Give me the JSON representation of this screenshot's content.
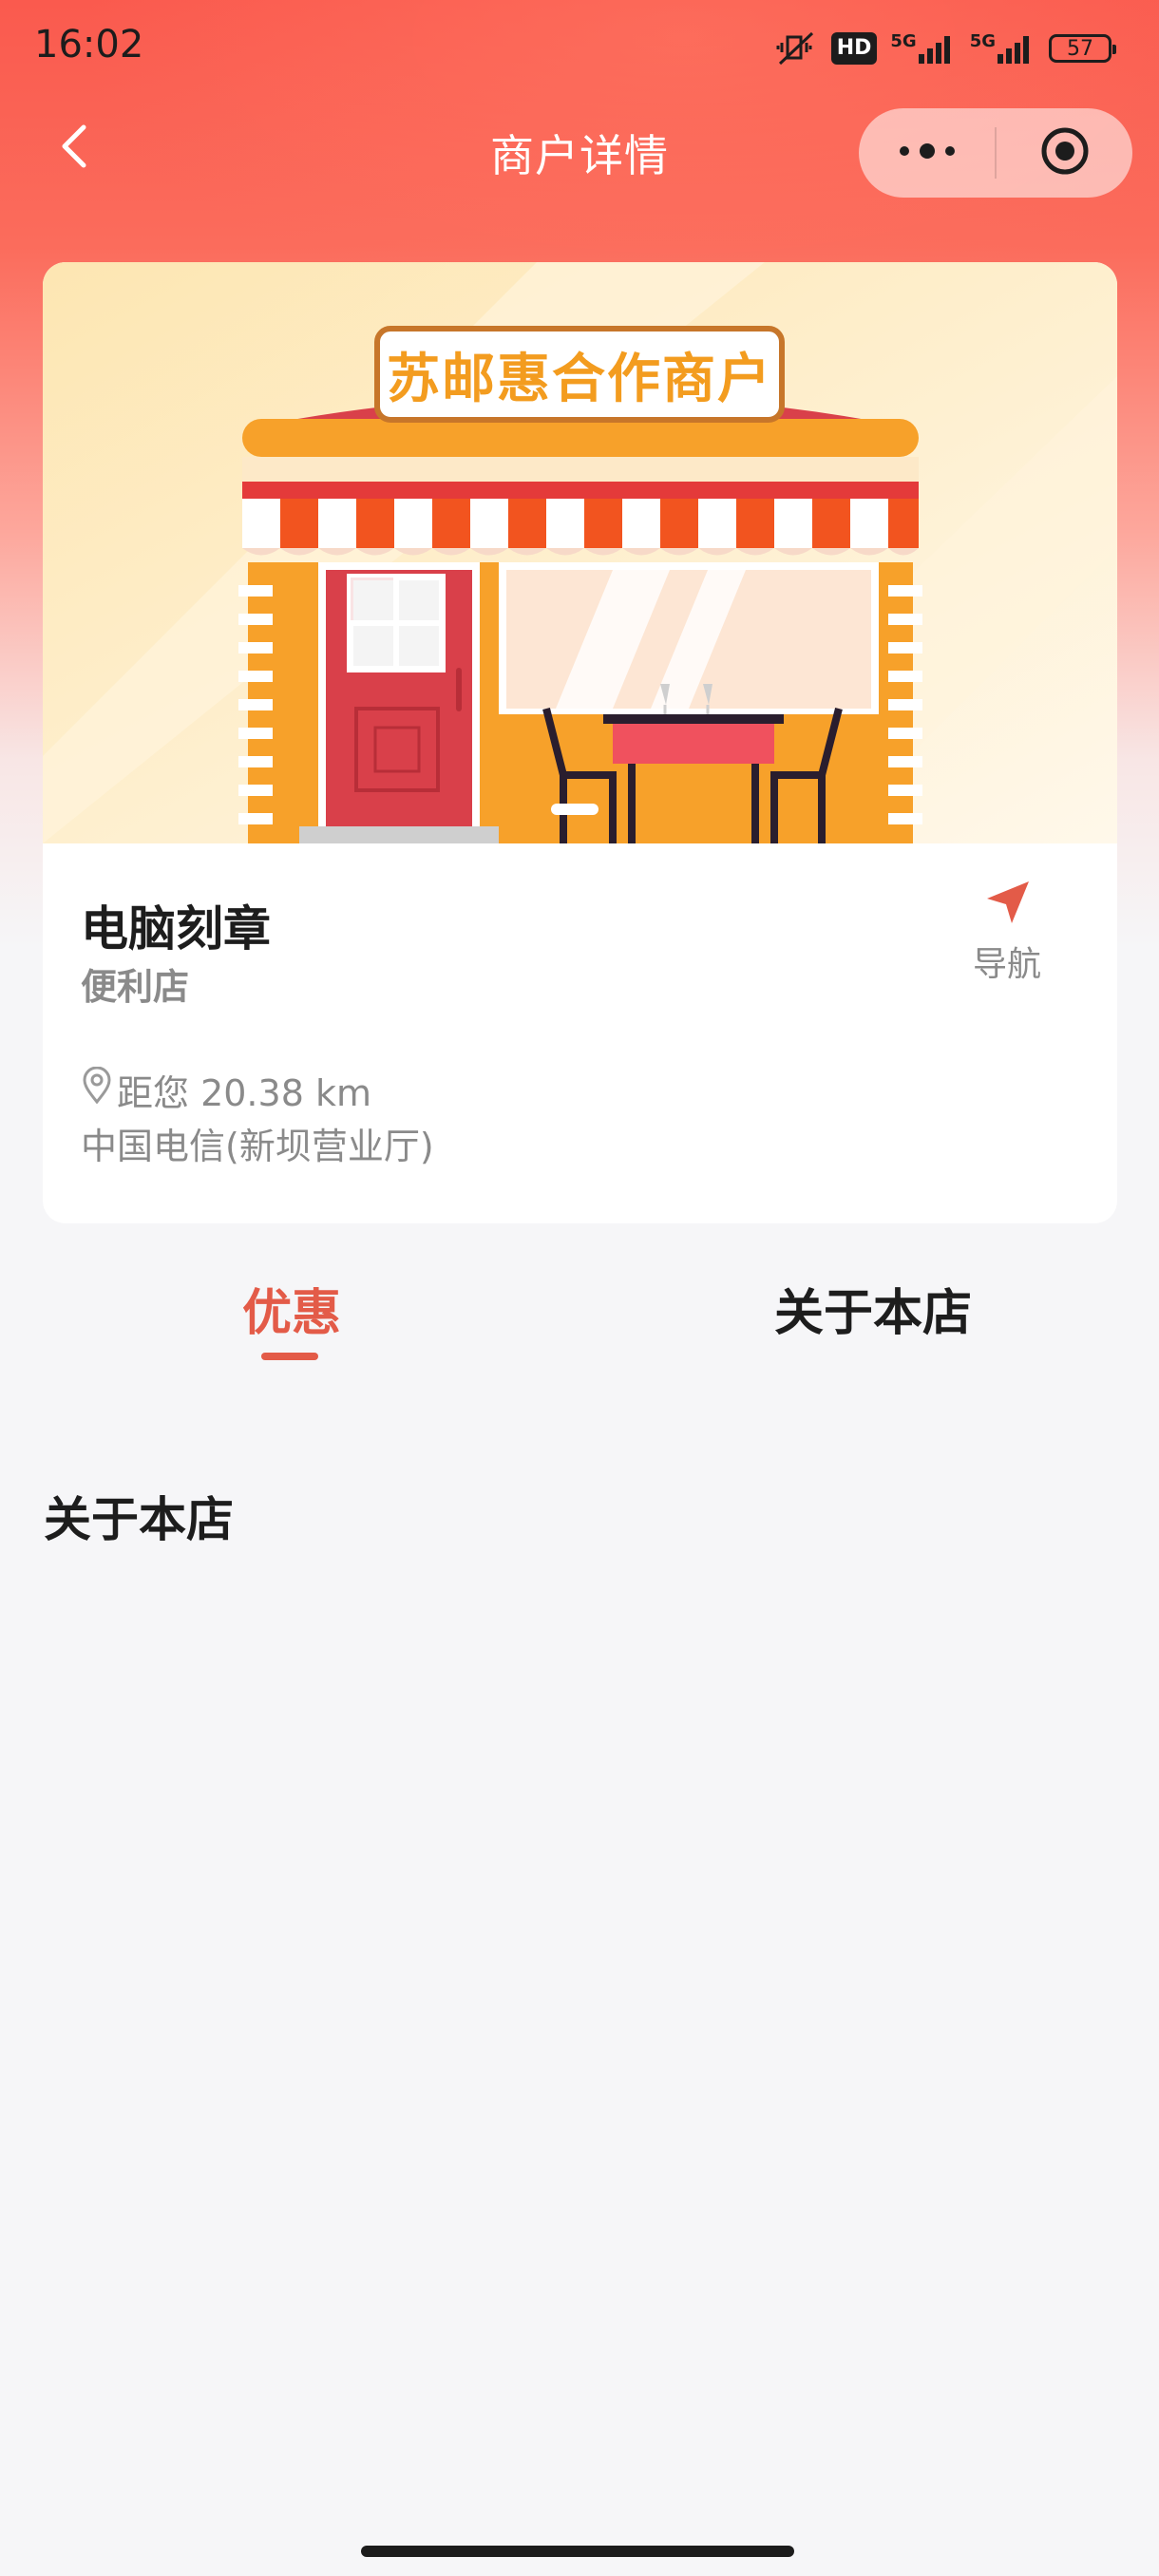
{
  "status_bar": {
    "time": "16:02",
    "hd_badge": "HD",
    "network_1": "5G",
    "network_2": "5G",
    "battery": "57"
  },
  "nav": {
    "title": "商户详情",
    "back_icon": "chevron-left-icon",
    "more_icon": "more-dots-icon",
    "close_icon": "target-circle-icon"
  },
  "store": {
    "banner_sign": "苏邮惠合作商户",
    "name": "电脑刻章",
    "category": "便利店",
    "navigate_label": "导航",
    "distance": "距您 20.38 km",
    "address": "中国电信(新坝营业厅)"
  },
  "tabs": [
    {
      "label": "优惠",
      "active": true
    },
    {
      "label": "关于本店",
      "active": false
    }
  ],
  "section": {
    "title": "关于本店"
  },
  "colors": {
    "accent": "#e35b48",
    "header_red": "#fa5a4e",
    "banner_orange": "#f9a826"
  }
}
